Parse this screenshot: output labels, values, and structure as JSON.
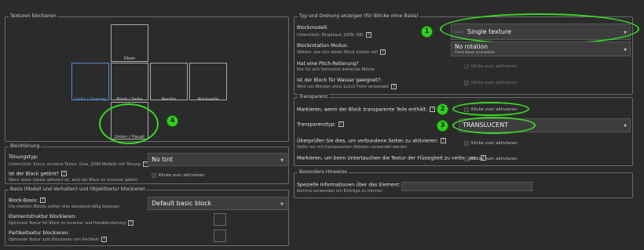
{
  "textures": {
    "legend": "Texturen blockieren",
    "top": "Oben",
    "left": "Links / Overlay",
    "front": "Front / Seite",
    "right": "Rechts",
    "back": "Rückseite",
    "bottom": "Unten / Haupt"
  },
  "tint": {
    "legend": "Blocktönung",
    "type_label": "Tönungstyp:",
    "type_sub": "Unterstützt: Kreuz, einzelne Textur, Gras, JSON-Modelle mit Tönung",
    "type_value": "No tint",
    "item_label": "Ist der Block getönt?",
    "item_sub": "Wenn diese Option aktiviert ist, wird der Block im Inventar getönt",
    "item_cb": "Klicke zum aktivieren"
  },
  "basis": {
    "legend": "Basis (Modell und Verhalten) und Objekttextur blockieren",
    "base_label": "Block-Basis:",
    "base_sub": "Die meisten Blöcke sollten dies standardmäßig belassen",
    "base_value": "Default basic block",
    "item_label": "Elementstruktur blockieren:",
    "item_sub": "Optionale Textur für Block im Inventar und Handdarstellung",
    "particle_label": "Partikeltextur blockieren:",
    "particle_sub": "Optionale Textur zum Blockieren von Partikeln"
  },
  "type": {
    "legend": "Typ und Drehung anzeigen (für Blöcke ohne Basis)",
    "model_label": "Blockmodell:",
    "model_sub": "Unterstützt: Eingebaut, JSON, OB)",
    "model_value": "Single texture",
    "model_icon_text": "BLOCK",
    "rot_label": "Blockrotation Modus:",
    "rot_sub": "Wählen, wie sich dieser Block drehen soll",
    "rot_value": "No rotation",
    "rot_value_sub": "Fixed block orientation",
    "pitch_label": "Hat eine Pitch-Rotierung?",
    "pitch_sub": "Nur für sich horizontal drehende Blöcke",
    "pitch_cb": "Klicke zum aktivieren",
    "water_label": "Ist der Block für Wasser geeignet?:",
    "water_sub": "Wird von Blöcken ohne 1x1x1 Form verwendet",
    "water_cb": "Klicke zum aktivieren"
  },
  "transparency": {
    "legend": "Transparenz",
    "has_label": "Markieren, wenn der Block transparente Teile enthält:",
    "has_cb": "Klicke zum aktivieren",
    "type_label": "Transparenztyp:",
    "type_value": "TRANSLUCENT",
    "connected_label": "Überprüfen Sie dies, um verbundene Seiten zu aktivieren:",
    "connected_sub": "Sollte nur mit transparenten Blöcken verwendet werden",
    "connected_cb": "Klicke zum aktivieren",
    "fluid_label": "Markieren, um beim Untertauchen die Textur der Flüssigkeit zu verbergen:",
    "fluid_cb": "Klicke zum aktivieren"
  },
  "notes": {
    "legend": "Besondere Hinweise",
    "label": "Spezielle Informationen über das Element:",
    "sub": "Komma verwenden um Einträge zu trennen",
    "value": ""
  },
  "annotations": [
    "1",
    "2",
    "3",
    "4"
  ],
  "help_glyph": "?",
  "caret_glyph": "▼",
  "colors": {
    "highlight": "#3bd627",
    "background": "#2b2b2b",
    "field": "#3d3d3d",
    "accent_blue": "#5a8ac8"
  }
}
